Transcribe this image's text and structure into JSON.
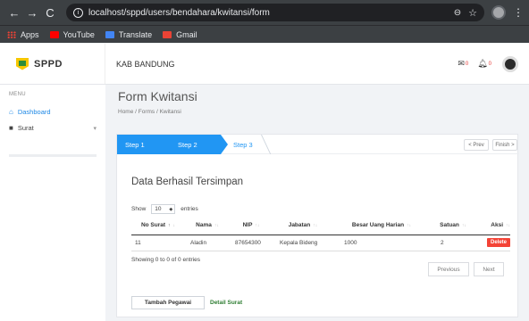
{
  "browser": {
    "url": "localhost/sppd/users/bendahara/kwitansi/form",
    "bookmarks": [
      "Apps",
      "YouTube",
      "Translate",
      "Gmail"
    ]
  },
  "app": {
    "brand": "SPPD",
    "region": "KAB BANDUNG",
    "mail_count": "0",
    "bell_count": "0"
  },
  "sidebar": {
    "menu_heading": "MENU",
    "items": [
      {
        "label": "Dashboard",
        "icon": "home-icon"
      },
      {
        "label": "Surat",
        "icon": "folder-icon"
      }
    ]
  },
  "page": {
    "title": "Form Kwitansi",
    "breadcrumb": "Home / Forms / Kwitansi"
  },
  "wizard": {
    "steps": [
      "Step 1",
      "Step 2",
      "Step 3"
    ],
    "prev_label": "< Prev",
    "finish_label": "Finish >"
  },
  "section": {
    "title": "Data Berhasil Tersimpan"
  },
  "table": {
    "show_label": "Show",
    "page_length": "10",
    "entries_label": "entries",
    "columns": [
      "No Surat",
      "Nama",
      "NIP",
      "Jabatan",
      "Besar Uang Harian",
      "Satuan",
      "Aksi"
    ],
    "rows": [
      {
        "no_surat": "11",
        "nama": "Aladin",
        "nip": "87654300",
        "jabatan": "Kepala Bideng",
        "besar_uang_harian": "1000",
        "satuan": "2",
        "aksi": "Delete"
      }
    ],
    "info": "Showing 0 to 0 of 0 entries",
    "previous_label": "Previous",
    "next_label": "Next"
  },
  "actions": {
    "tambah_pegawai": "Tambah Pegawai",
    "detail_surat": "Detail Surat"
  },
  "colors": {
    "primary": "#2196f3",
    "danger": "#f44336",
    "success_link": "#2e7d32"
  }
}
